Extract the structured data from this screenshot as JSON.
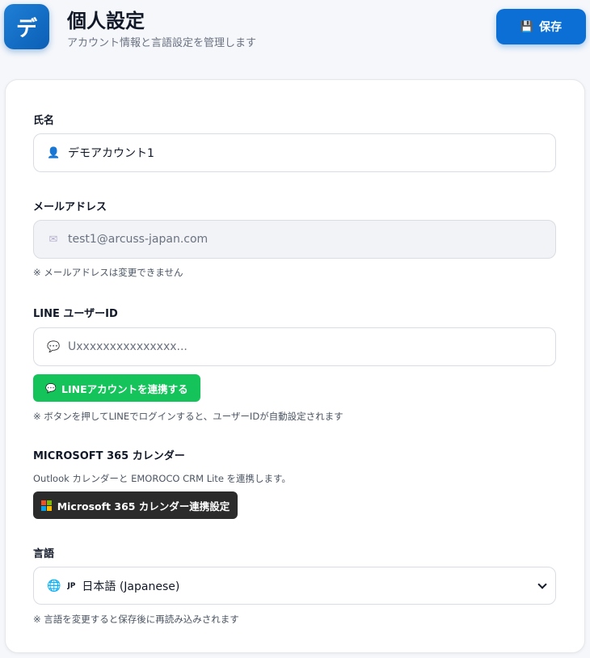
{
  "header": {
    "logo_text": "デ",
    "title": "個人設定",
    "subtitle": "アカウント情報と言語設定を管理します",
    "save_label": "保存"
  },
  "name": {
    "label": "氏名",
    "value": "デモアカウント1",
    "icon": "user-icon"
  },
  "email": {
    "label": "メールアドレス",
    "value": "test1@arcuss-japan.com",
    "note": "※ メールアドレスは変更できません",
    "icon": "envelope-icon"
  },
  "line": {
    "label": "LINE ユーザーID",
    "placeholder": "Uxxxxxxxxxxxxxxx...",
    "button_label": "LINEアカウントを連携する",
    "note": "※ ボタンを押してLINEでログインすると、ユーザーIDが自動設定されます",
    "icon": "speech-bubble-icon"
  },
  "microsoft": {
    "label": "MICROSOFT 365 カレンダー",
    "description": "Outlook カレンダーと EMOROCO CRM Lite を連携します。",
    "button_label": "Microsoft 365 カレンダー連携設定"
  },
  "language": {
    "label": "言語",
    "flag_text": "JP",
    "selected": "日本語 (Japanese)",
    "note": "※ 言語を変更すると保存後に再読み込みされます",
    "icon": "globe-icon"
  },
  "colors": {
    "primary": "#0b6fd6",
    "line_green": "#14c35a",
    "ms_button": "#2b2b2b"
  }
}
